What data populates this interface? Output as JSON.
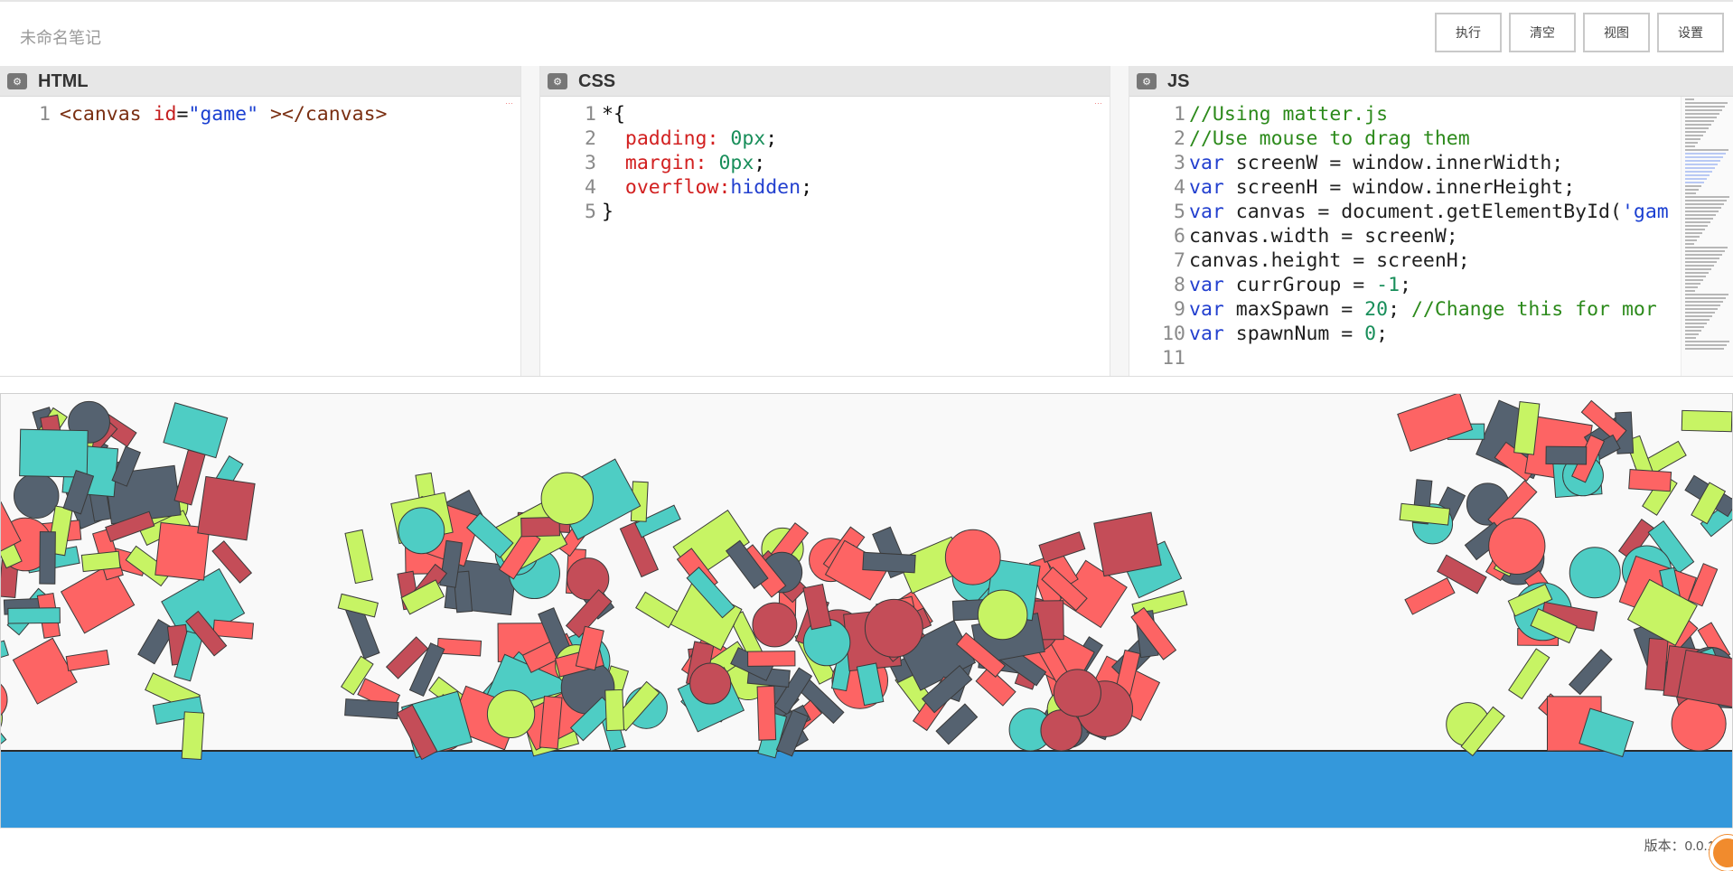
{
  "topbar": {
    "title": "未命名笔记",
    "buttons": [
      "执行",
      "清空",
      "视图",
      "设置"
    ]
  },
  "panels": {
    "html": {
      "title": "HTML",
      "lines": [
        [
          "1",
          [
            [
              "tag",
              "<canvas "
            ],
            [
              "attr",
              "id"
            ],
            [
              "sel",
              "="
            ],
            [
              "str",
              "\"game\""
            ],
            [
              "tag",
              " ></canvas>"
            ]
          ]
        ]
      ]
    },
    "css": {
      "title": "CSS",
      "lines": [
        [
          "1",
          [
            [
              "sel",
              "*{"
            ]
          ]
        ],
        [
          "2",
          [
            [
              "sel",
              "  "
            ],
            [
              "prop",
              "padding: "
            ],
            [
              "num",
              "0px"
            ],
            [
              "sel",
              ";"
            ]
          ]
        ],
        [
          "3",
          [
            [
              "sel",
              "  "
            ],
            [
              "prop",
              "margin: "
            ],
            [
              "num",
              "0px"
            ],
            [
              "sel",
              ";"
            ]
          ]
        ],
        [
          "4",
          [
            [
              "sel",
              "  "
            ],
            [
              "prop",
              "overflow:"
            ],
            [
              "kw",
              "hidden"
            ],
            [
              "sel",
              ";"
            ]
          ]
        ],
        [
          "5",
          [
            [
              "sel",
              "}"
            ]
          ]
        ]
      ]
    },
    "js": {
      "title": "JS",
      "lines": [
        [
          "1",
          [
            [
              "comment",
              "//Using matter.js"
            ]
          ]
        ],
        [
          "2",
          [
            [
              "comment",
              "//Use mouse to drag them"
            ]
          ]
        ],
        [
          "3",
          [
            [
              "kw",
              "var "
            ],
            [
              "id",
              "screenW = window.innerWidth;"
            ]
          ]
        ],
        [
          "4",
          [
            [
              "kw",
              "var "
            ],
            [
              "id",
              "screenH = window.innerHeight;"
            ]
          ]
        ],
        [
          "5",
          [
            [
              "kw",
              "var "
            ],
            [
              "id",
              "canvas = document.getElementById("
            ],
            [
              "str",
              "'gam"
            ]
          ]
        ],
        [
          "6",
          [
            [
              "id",
              "canvas.width = screenW;"
            ]
          ]
        ],
        [
          "7",
          [
            [
              "id",
              "canvas.height = screenH;"
            ]
          ]
        ],
        [
          "8",
          [
            [
              "kw",
              "var "
            ],
            [
              "id",
              "currGroup = "
            ],
            [
              "num",
              "-1"
            ],
            [
              "id",
              ";"
            ]
          ]
        ],
        [
          "9",
          [
            [
              "kw",
              "var "
            ],
            [
              "id",
              "maxSpawn = "
            ],
            [
              "num",
              "20"
            ],
            [
              "id",
              "; "
            ],
            [
              "comment",
              "//Change this for mor"
            ]
          ]
        ],
        [
          "10",
          [
            [
              "kw",
              "var "
            ],
            [
              "id",
              "spawnNum = "
            ],
            [
              "num",
              "0"
            ],
            [
              "id",
              ";"
            ]
          ]
        ],
        [
          "11",
          []
        ]
      ]
    }
  },
  "simulation": {
    "colors": {
      "coral": "#fd6464",
      "crimson": "#c44d58",
      "teal": "#4ecdc4",
      "slate": "#556270",
      "lime": "#c7f464",
      "ground": "#3498db"
    }
  },
  "status": {
    "version": "版本：0.0.1"
  }
}
